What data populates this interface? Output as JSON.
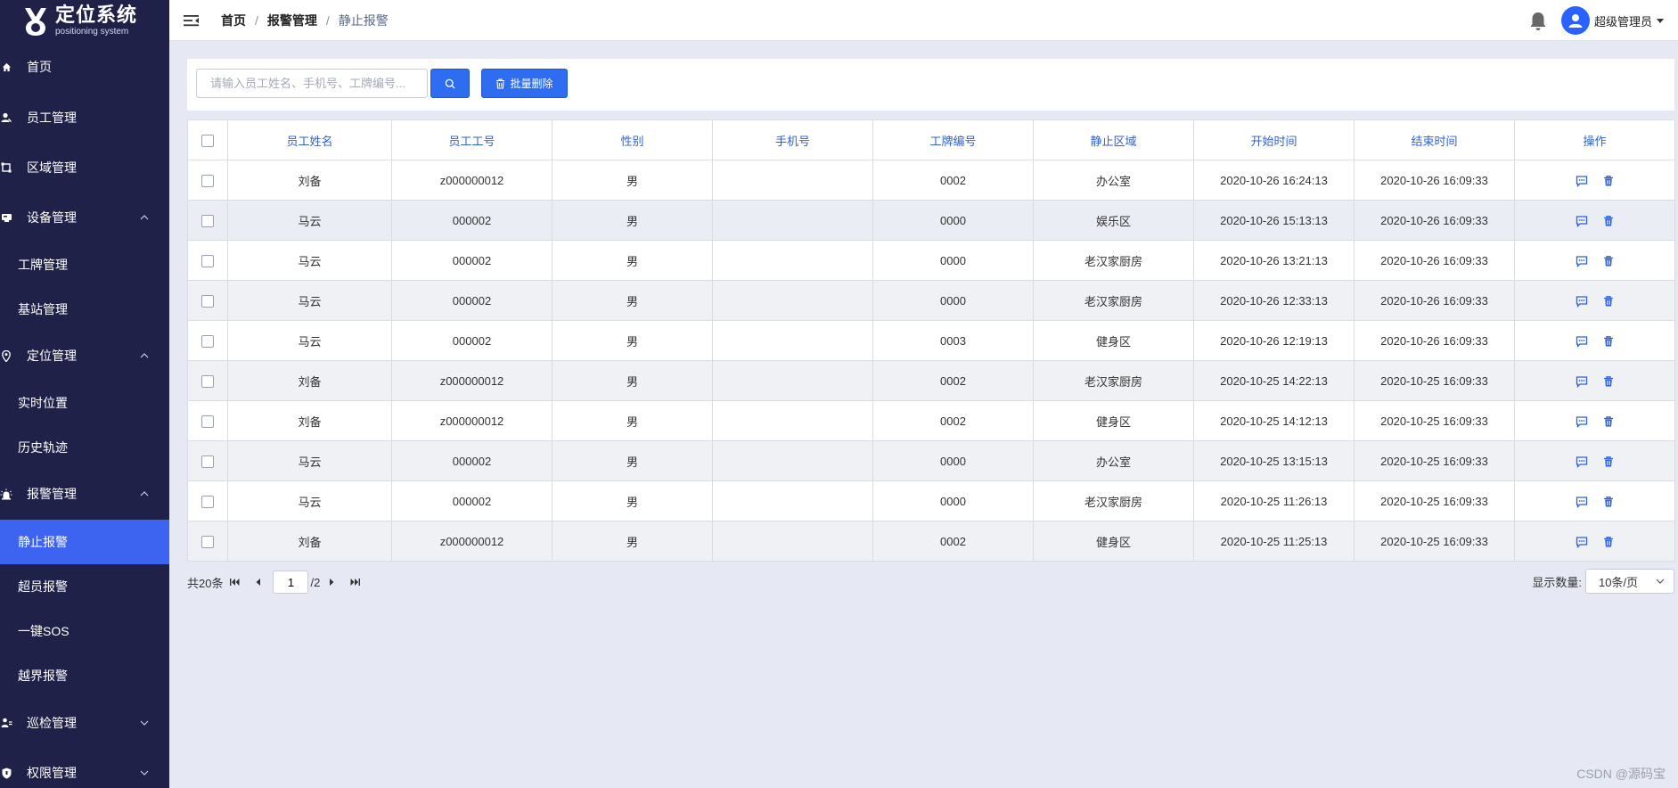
{
  "app": {
    "title": "定位系统",
    "subtitle": "positioning system"
  },
  "sidebar": {
    "items": [
      {
        "label": "首页",
        "icon": "home-icon"
      },
      {
        "label": "员工管理",
        "icon": "users-icon"
      },
      {
        "label": "区域管理",
        "icon": "area-icon"
      },
      {
        "label": "设备管理",
        "icon": "device-icon",
        "expanded": true
      },
      {
        "label": "定位管理",
        "icon": "location-icon",
        "expanded": true
      },
      {
        "label": "报警管理",
        "icon": "alarm-icon",
        "expanded": true
      },
      {
        "label": "巡检管理",
        "icon": "patrol-icon",
        "expanded": false
      },
      {
        "label": "权限管理",
        "icon": "shield-icon",
        "expanded": false
      }
    ],
    "subitems": {
      "device": [
        "工牌管理",
        "基站管理"
      ],
      "location": [
        "实时位置",
        "历史轨迹"
      ],
      "alarm": [
        "静止报警",
        "超员报警",
        "一键SOS",
        "越界报警"
      ]
    },
    "active": "静止报警"
  },
  "header": {
    "breadcrumb": [
      "首页",
      "报警管理",
      "静止报警"
    ],
    "separator": "/",
    "user_name": "超级管理员"
  },
  "toolbar": {
    "search_placeholder": "请输入员工姓名、手机号、工牌编号...",
    "search_value": "",
    "batch_delete_label": "批量删除"
  },
  "table": {
    "columns": [
      "员工姓名",
      "员工工号",
      "性别",
      "手机号",
      "工牌编号",
      "静止区域",
      "开始时间",
      "结束时间",
      "操作"
    ],
    "rows": [
      {
        "name": "刘备",
        "id": "z000000012",
        "gender": "男",
        "phone": "",
        "badge": "0002",
        "area": "办公室",
        "start": "2020-10-26 16:24:13",
        "end": "2020-10-26 16:09:33"
      },
      {
        "name": "马云",
        "id": "000002",
        "gender": "男",
        "phone": "",
        "badge": "0000",
        "area": "娱乐区",
        "start": "2020-10-26 15:13:13",
        "end": "2020-10-26 16:09:33"
      },
      {
        "name": "马云",
        "id": "000002",
        "gender": "男",
        "phone": "",
        "badge": "0000",
        "area": "老汉家厨房",
        "start": "2020-10-26 13:21:13",
        "end": "2020-10-26 16:09:33"
      },
      {
        "name": "马云",
        "id": "000002",
        "gender": "男",
        "phone": "",
        "badge": "0000",
        "area": "老汉家厨房",
        "start": "2020-10-26 12:33:13",
        "end": "2020-10-26 16:09:33"
      },
      {
        "name": "马云",
        "id": "000002",
        "gender": "男",
        "phone": "",
        "badge": "0003",
        "area": "健身区",
        "start": "2020-10-26 12:19:13",
        "end": "2020-10-26 16:09:33"
      },
      {
        "name": "刘备",
        "id": "z000000012",
        "gender": "男",
        "phone": "",
        "badge": "0002",
        "area": "老汉家厨房",
        "start": "2020-10-25 14:22:13",
        "end": "2020-10-25 16:09:33"
      },
      {
        "name": "刘备",
        "id": "z000000012",
        "gender": "男",
        "phone": "",
        "badge": "0002",
        "area": "健身区",
        "start": "2020-10-25 14:12:13",
        "end": "2020-10-25 16:09:33"
      },
      {
        "name": "马云",
        "id": "000002",
        "gender": "男",
        "phone": "",
        "badge": "0000",
        "area": "办公室",
        "start": "2020-10-25 13:15:13",
        "end": "2020-10-25 16:09:33"
      },
      {
        "name": "马云",
        "id": "000002",
        "gender": "男",
        "phone": "",
        "badge": "0000",
        "area": "老汉家厨房",
        "start": "2020-10-25 11:26:13",
        "end": "2020-10-25 16:09:33"
      },
      {
        "name": "刘备",
        "id": "z000000012",
        "gender": "男",
        "phone": "",
        "badge": "0002",
        "area": "健身区",
        "start": "2020-10-25 11:25:13",
        "end": "2020-10-25 16:09:33"
      }
    ]
  },
  "pagination": {
    "total_label": "共20条",
    "current_page": "1",
    "total_pages_label": "/2",
    "page_size_label": "显示数量:",
    "page_size_value": "10条/页"
  },
  "watermark": "CSDN @源码宝",
  "colors": {
    "sidebar_bg": "#1f2148",
    "active_item": "#3d63f1",
    "primary": "#2f6df0",
    "header_text": "#2f62d4"
  }
}
